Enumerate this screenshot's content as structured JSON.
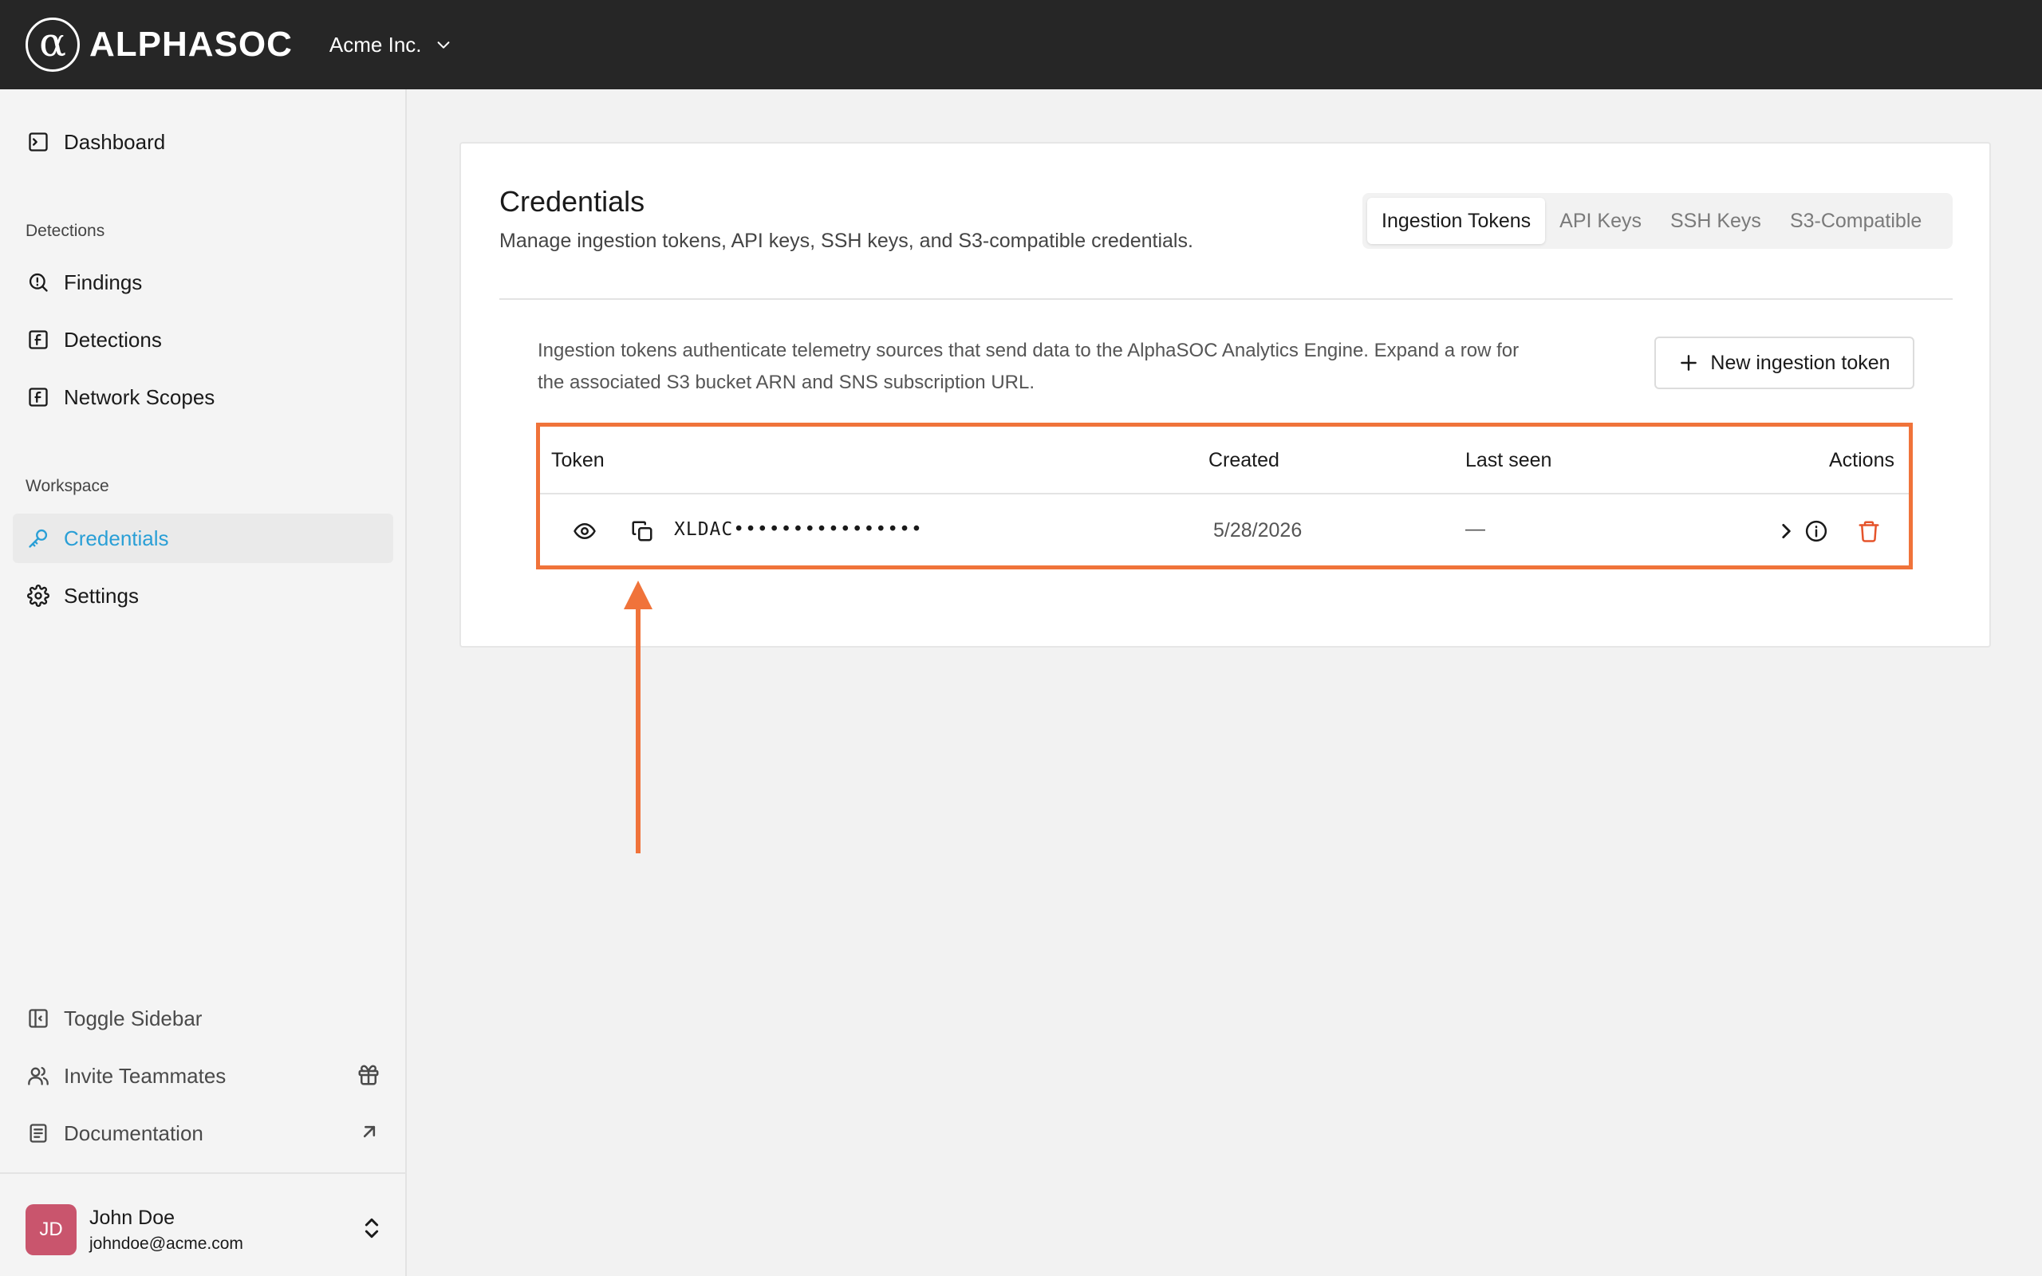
{
  "brand": {
    "name": "ALPHASOC",
    "mark": "α"
  },
  "org": {
    "name": "Acme Inc."
  },
  "sidebar": {
    "dashboard": "Dashboard",
    "detections_section": "Detections",
    "findings": "Findings",
    "detections": "Detections",
    "network_scopes": "Network Scopes",
    "workspace_section": "Workspace",
    "credentials": "Credentials",
    "settings": "Settings",
    "toggle_sidebar": "Toggle Sidebar",
    "invite_teammates": "Invite Teammates",
    "documentation": "Documentation"
  },
  "user": {
    "initials": "JD",
    "name": "John Doe",
    "email": "johndoe@acme.com"
  },
  "page": {
    "title": "Credentials",
    "subtitle": "Manage ingestion tokens, API keys, SSH keys, and S3-compatible credentials.",
    "tabs": [
      "Ingestion Tokens",
      "API Keys",
      "SSH Keys",
      "S3-Compatible"
    ],
    "active_tab": "Ingestion Tokens",
    "intro_line1": "Ingestion tokens authenticate telemetry sources that send data to the AlphaSOC Analytics Engine. Expand a row for",
    "intro_line2": "the associated S3 bucket ARN and SNS subscription URL.",
    "new_button": "New ingestion token"
  },
  "table": {
    "columns": {
      "token": "Token",
      "created": "Created",
      "last_seen": "Last seen",
      "actions": "Actions"
    },
    "rows": [
      {
        "token": "XLDAC••••••••••••••••",
        "created": "5/28/2026",
        "last_seen": "—"
      }
    ]
  },
  "colors": {
    "accent": "#2a9fd6",
    "highlight": "#f0733a",
    "danger": "#e5542b",
    "topbar": "#262626"
  }
}
